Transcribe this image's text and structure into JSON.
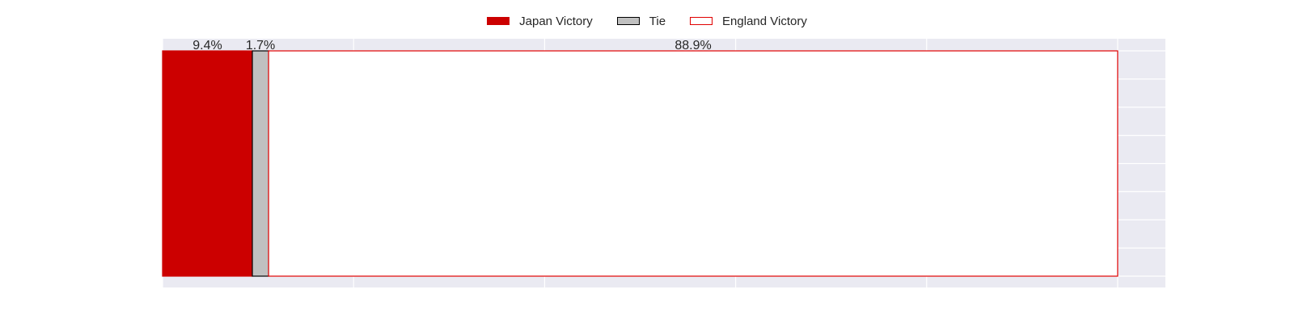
{
  "chart_data": {
    "type": "bar",
    "orientation": "horizontal-stacked",
    "categories": [
      ""
    ],
    "series": [
      {
        "name": "Japan Victory",
        "values": [
          9.4
        ],
        "label": "9.4%",
        "color": "#cc0000",
        "edge": "#cc0000",
        "fill": "#cc0000"
      },
      {
        "name": "Tie",
        "values": [
          1.7
        ],
        "label": "1.7%",
        "color": "#c0c0c0",
        "edge": "#000000",
        "fill": "#c0c0c0"
      },
      {
        "name": "England Victory",
        "values": [
          88.9
        ],
        "label": "88.9%",
        "color": "#e00000",
        "edge": "#e00000",
        "fill": "#ffffff"
      }
    ],
    "xlim": [
      0,
      105
    ],
    "grid": true,
    "legend_position": "top-center",
    "background": "#eaeaf2"
  }
}
